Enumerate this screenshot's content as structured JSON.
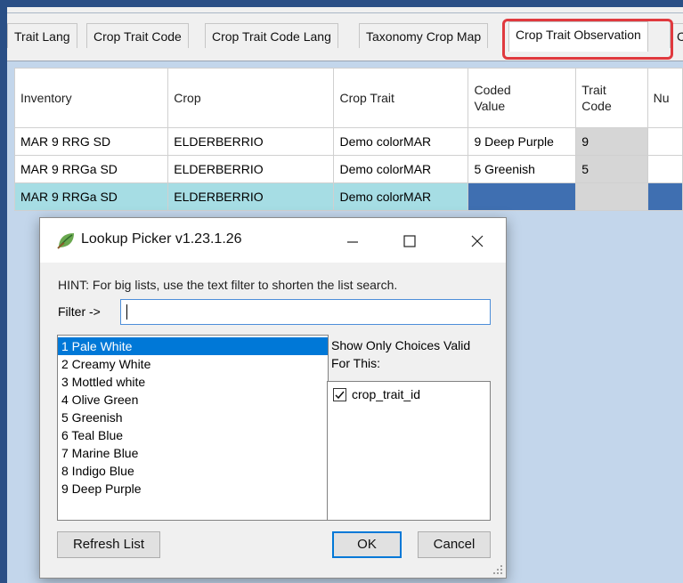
{
  "tabs": [
    {
      "label": "Trait Lang"
    },
    {
      "label": "Crop Trait Code"
    },
    {
      "label": "Crop Trait Code Lang"
    },
    {
      "label": "Taxonomy Crop Map"
    },
    {
      "label": "Crop Trait Observation"
    },
    {
      "label": "C"
    }
  ],
  "grid": {
    "columns": [
      "Inventory",
      "Crop",
      "Crop Trait",
      "Coded Value",
      "Trait Code",
      "Nu"
    ],
    "rows": [
      {
        "inventory": "MAR 9 RRG SD",
        "crop": "ELDERBERRIO",
        "crop_trait": "Demo colorMAR",
        "coded_value": "9 Deep Purple",
        "trait_code": "9"
      },
      {
        "inventory": "MAR 9 RRGa SD",
        "crop": "ELDERBERRIO",
        "crop_trait": "Demo colorMAR",
        "coded_value": "5 Greenish",
        "trait_code": "5"
      },
      {
        "inventory": "MAR 9 RRGa SD",
        "crop": "ELDERBERRIO",
        "crop_trait": "Demo colorMAR",
        "coded_value": "",
        "trait_code": ""
      }
    ]
  },
  "dialog": {
    "title": "Lookup Picker v1.23.1.26",
    "hint": "HINT: For big lists, use the text filter to shorten the list search.",
    "filter_label": "Filter ->",
    "filter_value": "",
    "items": [
      "1 Pale White",
      "2 Creamy White",
      "3 Mottled white",
      "4 Olive Green",
      "5 Greenish",
      "6 Teal Blue",
      "7 Marine Blue",
      "8 Indigo Blue",
      "9 Deep Purple"
    ],
    "selected_index": 0,
    "choices_label": "Show Only Choices Valid For This:",
    "checkbox_label": "crop_trait_id",
    "checkbox_checked": true,
    "refresh_label": "Refresh List",
    "ok_label": "OK",
    "cancel_label": "Cancel"
  },
  "colors": {
    "highlight": "#e0393e",
    "selection": "#0078d7",
    "row_selected": "#a6dde4"
  }
}
